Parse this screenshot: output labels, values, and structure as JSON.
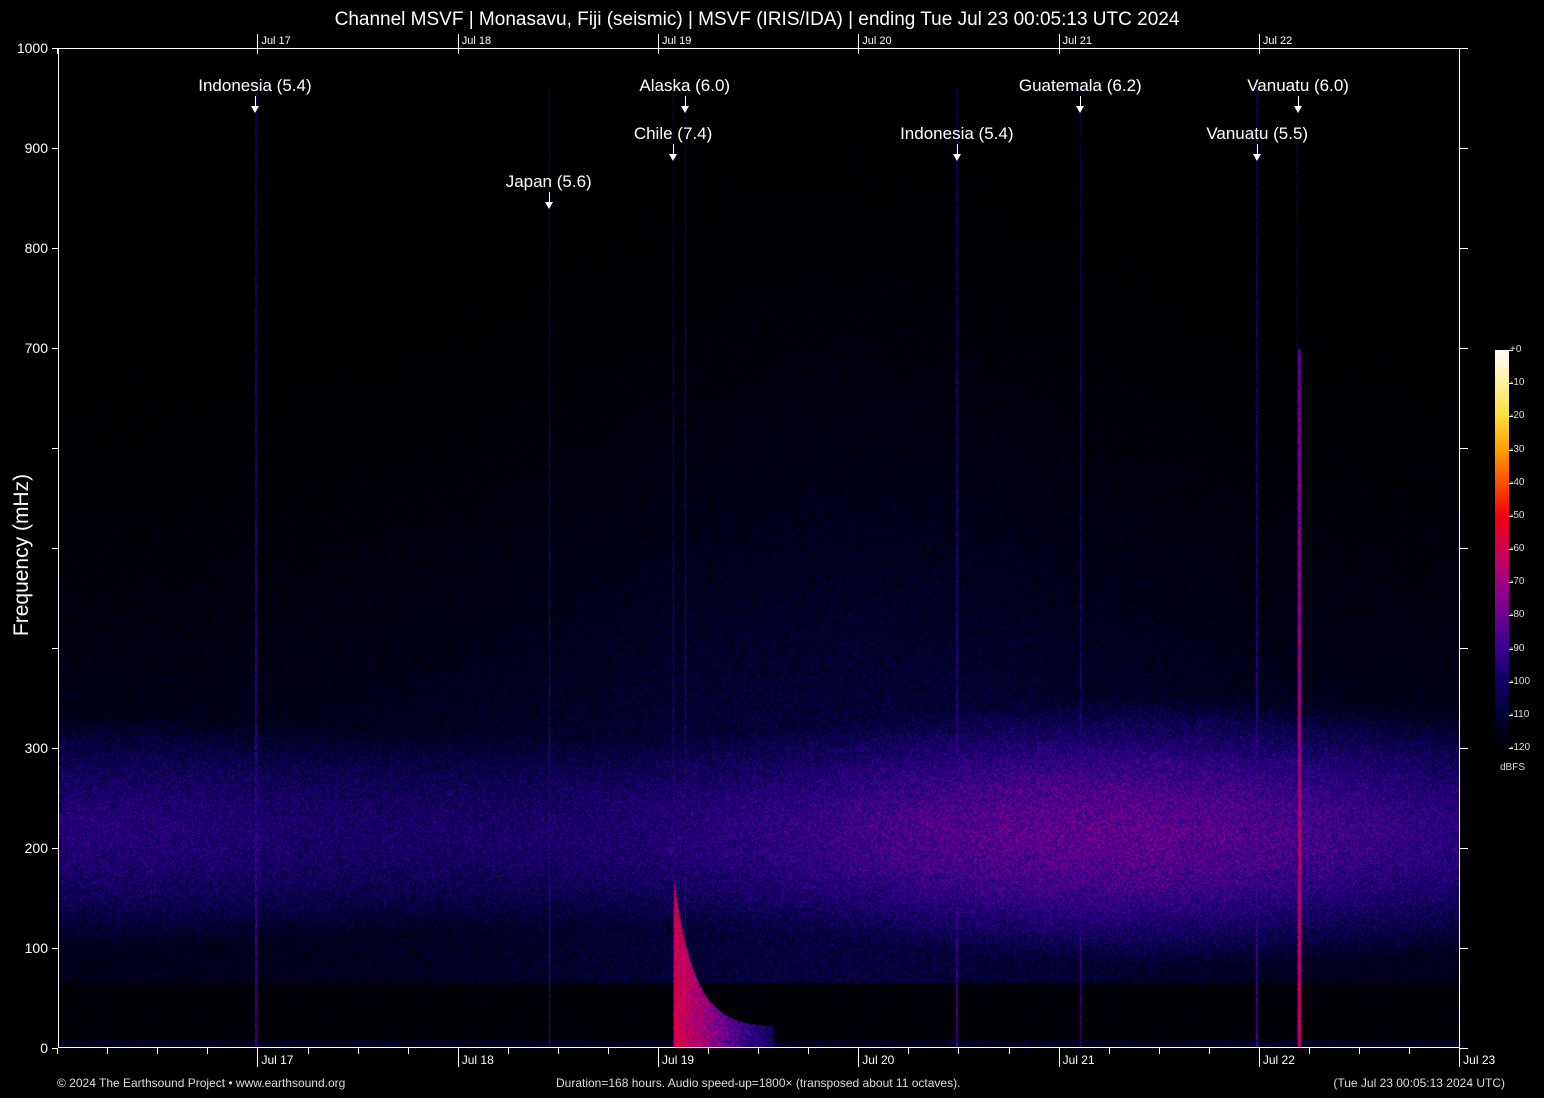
{
  "title": "Channel MSVF | Monasavu, Fiji (seismic) | MSVF (IRIS/IDA) | ending Tue Jul 23 00:05:13 UTC 2024",
  "colors": {
    "background": "#000000",
    "axis": "#ffffff"
  },
  "chart_data": {
    "type": "heatmap",
    "title": "Channel MSVF | Monasavu, Fiji (seismic) | MSVF (IRIS/IDA) | ending Tue Jul 23 00:05:13 UTC 2024",
    "ylabel": "Frequency (mHz)",
    "ylim": [
      0,
      1000
    ],
    "yticks": [
      0,
      100,
      200,
      300,
      400,
      500,
      600,
      700,
      800,
      900,
      1000
    ],
    "ytick_labels": [
      "0",
      "100",
      "200",
      "300",
      "",
      "",
      "",
      "700",
      "800",
      "900",
      "1000"
    ],
    "xlim_hours": [
      0,
      168
    ],
    "xtick_labels": [
      "Jul 17",
      "Jul 18",
      "Jul 19",
      "Jul 20",
      "Jul 21",
      "Jul 22",
      "Jul 23"
    ],
    "xtick_hours": [
      23.9,
      47.9,
      71.9,
      95.9,
      119.9,
      143.9,
      167.9
    ],
    "colorbar": {
      "label": "dBFS",
      "ticks": [
        "+0",
        "-10",
        "-20",
        "-30",
        "-40",
        "-50",
        "-60",
        "-70",
        "-80",
        "-90",
        "-100",
        "-110",
        "-120"
      ],
      "range": [
        -120,
        0
      ]
    },
    "events": [
      {
        "label": "Indonesia (5.4)",
        "hour": 23.6
      },
      {
        "label": "Japan (5.6)",
        "hour": 58.8
      },
      {
        "label": "Chile (7.4)",
        "hour": 73.7
      },
      {
        "label": "Alaska (6.0)",
        "hour": 75.1
      },
      {
        "label": "Indonesia (5.4)",
        "hour": 107.7
      },
      {
        "label": "Guatemala (6.2)",
        "hour": 122.5
      },
      {
        "label": "Vanuatu (5.5)",
        "hour": 143.7
      },
      {
        "label": "Vanuatu (6.0)",
        "hour": 148.6
      }
    ]
  },
  "footer": {
    "left": "© 2024 The Earthsound Project • www.earthsound.org",
    "center": "Duration=168 hours. Audio speed-up=1800× (transposed about 11 octaves).",
    "right": "(Tue Jul 23 00:05:13 2024 UTC)"
  }
}
